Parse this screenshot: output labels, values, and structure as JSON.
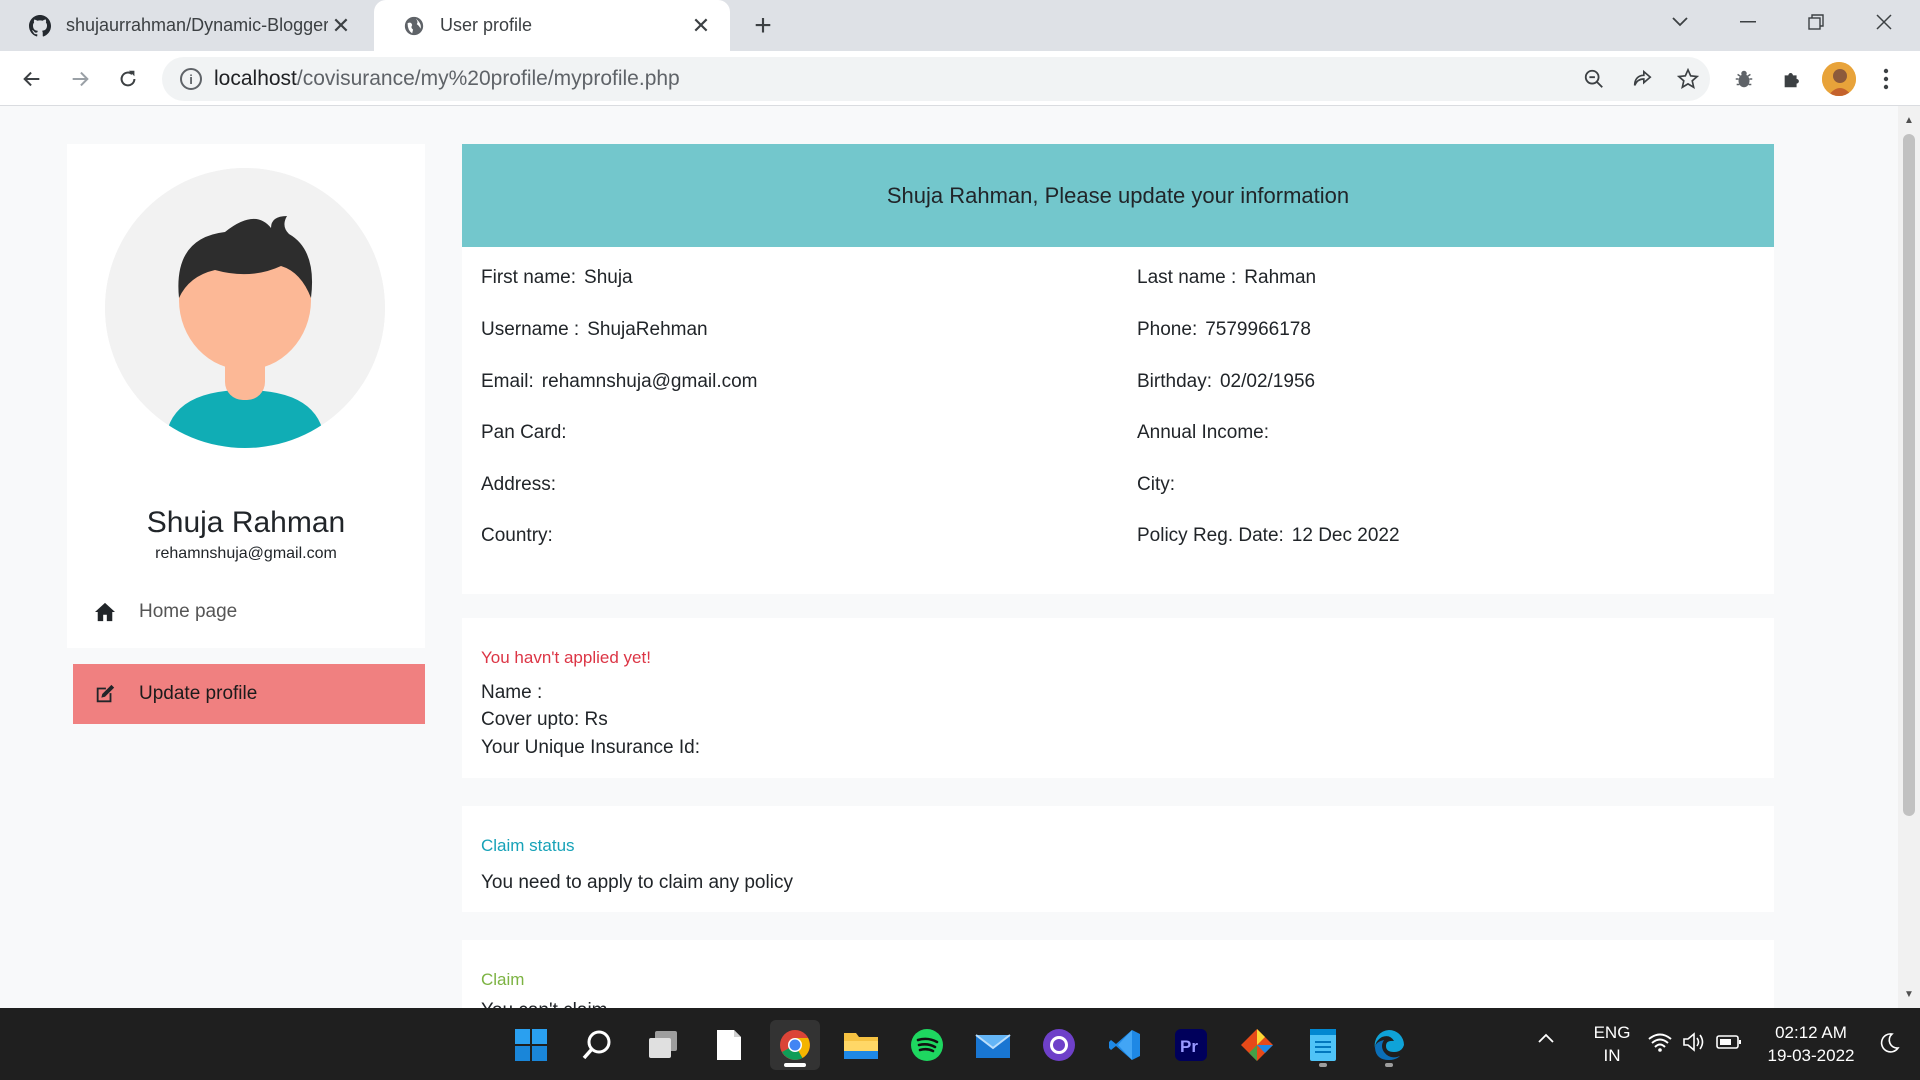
{
  "browser": {
    "tabs": [
      {
        "title": "shujaurrahman/Dynamic-Blogger",
        "icon": "github-icon"
      },
      {
        "title": "User profile",
        "icon": "globe-icon",
        "active": true
      }
    ],
    "url_host": "localhost",
    "url_path": "/covisurance/my%20profile/myprofile.php"
  },
  "sidebar": {
    "name": "Shuja Rahman",
    "email": "rehamnshuja@gmail.com",
    "items": [
      {
        "label": "Home page",
        "icon": "home-icon"
      },
      {
        "label": "Update profile",
        "icon": "edit-icon",
        "active": true
      }
    ]
  },
  "info": {
    "header": "Shuja Rahman, Please update your information",
    "left": [
      {
        "label": "First name:",
        "value": "Shuja"
      },
      {
        "label": "Username :",
        "value": "ShujaRehman"
      },
      {
        "label": "Email:",
        "value": "rehamnshuja@gmail.com"
      },
      {
        "label": "Pan Card:",
        "value": ""
      },
      {
        "label": "Address:",
        "value": ""
      },
      {
        "label": "Country:",
        "value": ""
      }
    ],
    "right": [
      {
        "label": "Last name :",
        "value": "Rahman"
      },
      {
        "label": "Phone:",
        "value": "7579966178"
      },
      {
        "label": "Birthday:",
        "value": "02/02/1956"
      },
      {
        "label": "Annual Income:",
        "value": ""
      },
      {
        "label": "City:",
        "value": ""
      },
      {
        "label": "Policy Reg. Date:",
        "value": "12 Dec 2022"
      }
    ]
  },
  "application": {
    "status": "You havn't applied yet!",
    "name_label": "Name :",
    "cover_label": "Cover upto: Rs",
    "unique_id_label": "Your Unique Insurance Id:"
  },
  "claim_status": {
    "title": "Claim status",
    "message": "You need to apply to claim any policy"
  },
  "claim": {
    "title": "Claim",
    "message": "You can't claim"
  },
  "taskbar": {
    "apps": [
      "windows-start-icon",
      "search-icon",
      "task-view-icon",
      "notepad-icon",
      "chrome-icon",
      "file-explorer-icon",
      "spotify-icon",
      "mail-icon",
      "github-desktop-icon",
      "vscode-icon",
      "premiere-pro-icon",
      "git-icon",
      "notes-icon",
      "edge-icon"
    ],
    "language": "ENG",
    "region": "IN",
    "time": "02:12 AM",
    "date": "19-03-2022"
  },
  "colors": {
    "header_bg": "#73c7cc",
    "active_nav": "#f08080",
    "status_red": "#dc3545",
    "claim_status_teal": "#17a2b8",
    "claim_green": "#7cb342"
  }
}
